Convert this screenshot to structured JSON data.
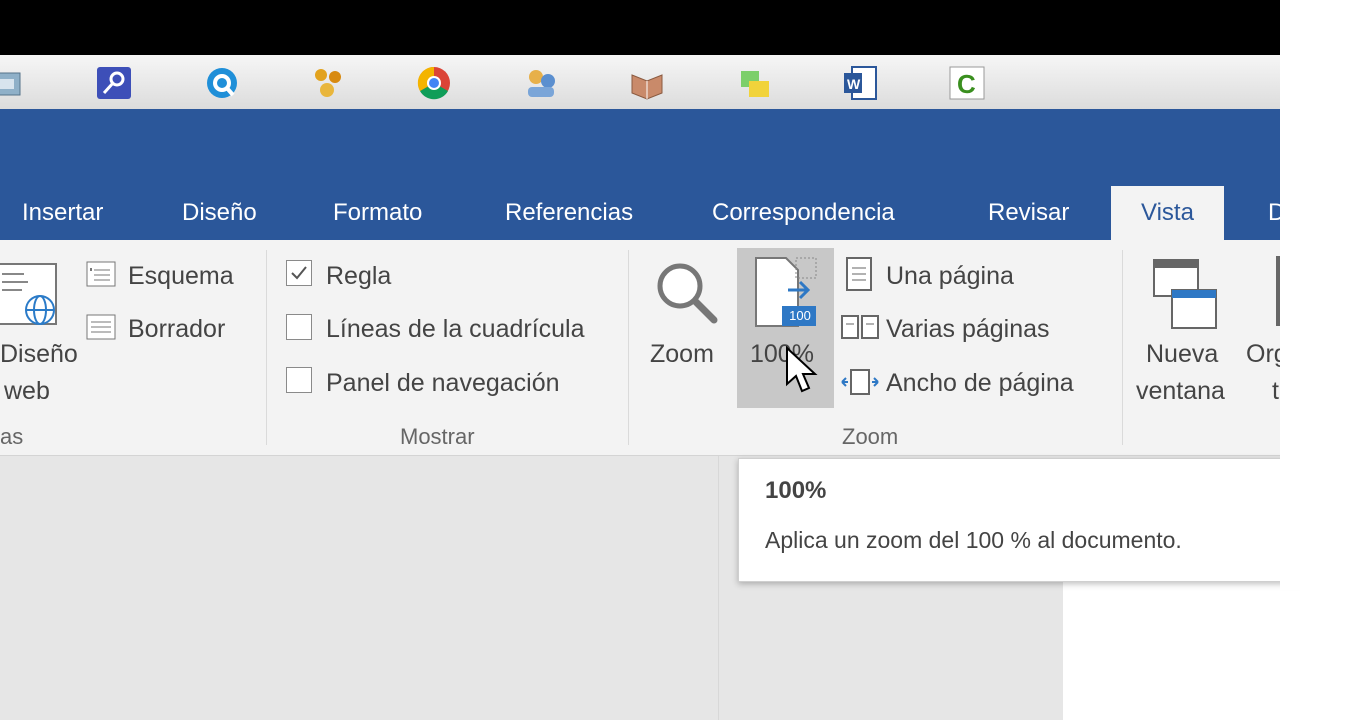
{
  "taskbar": {
    "icons": [
      "printer-icon",
      "key-app-icon",
      "quicktime-icon",
      "people-icon",
      "chrome-icon",
      "users-icon",
      "book-icon",
      "folders-icon",
      "word-icon",
      "camtasia-icon"
    ]
  },
  "ribbon_tabs": [
    "Insertar",
    "Diseño",
    "Formato",
    "Referencias",
    "Correspondencia",
    "Revisar",
    "Vista",
    "D"
  ],
  "active_tab": "Vista",
  "views_group": {
    "diseno_web_line1": "Diseño",
    "diseno_web_line2": "web",
    "esquema": "Esquema",
    "borrador": "Borrador",
    "group_label": "as"
  },
  "mostrar_group": {
    "regla": "Regla",
    "regla_checked": true,
    "lineas": "Líneas de la cuadrícula",
    "lineas_checked": false,
    "panel": "Panel de navegación",
    "panel_checked": false,
    "group_label": "Mostrar"
  },
  "zoom_group": {
    "zoom": "Zoom",
    "hundred": "100%",
    "hundred_badge": "100",
    "una_pagina": "Una página",
    "varias_paginas": "Varias páginas",
    "ancho_pagina": "Ancho de página",
    "group_label": "Zoom"
  },
  "window_group": {
    "nueva_line1": "Nueva",
    "nueva_line2": "ventana",
    "org_line1": "Org",
    "org_line2": "t"
  },
  "tooltip": {
    "title": "100%",
    "description": "Aplica un zoom del 100 % al documento."
  },
  "colors": {
    "accent": "#2b579a",
    "ribbon_bg": "#f3f3f3"
  }
}
